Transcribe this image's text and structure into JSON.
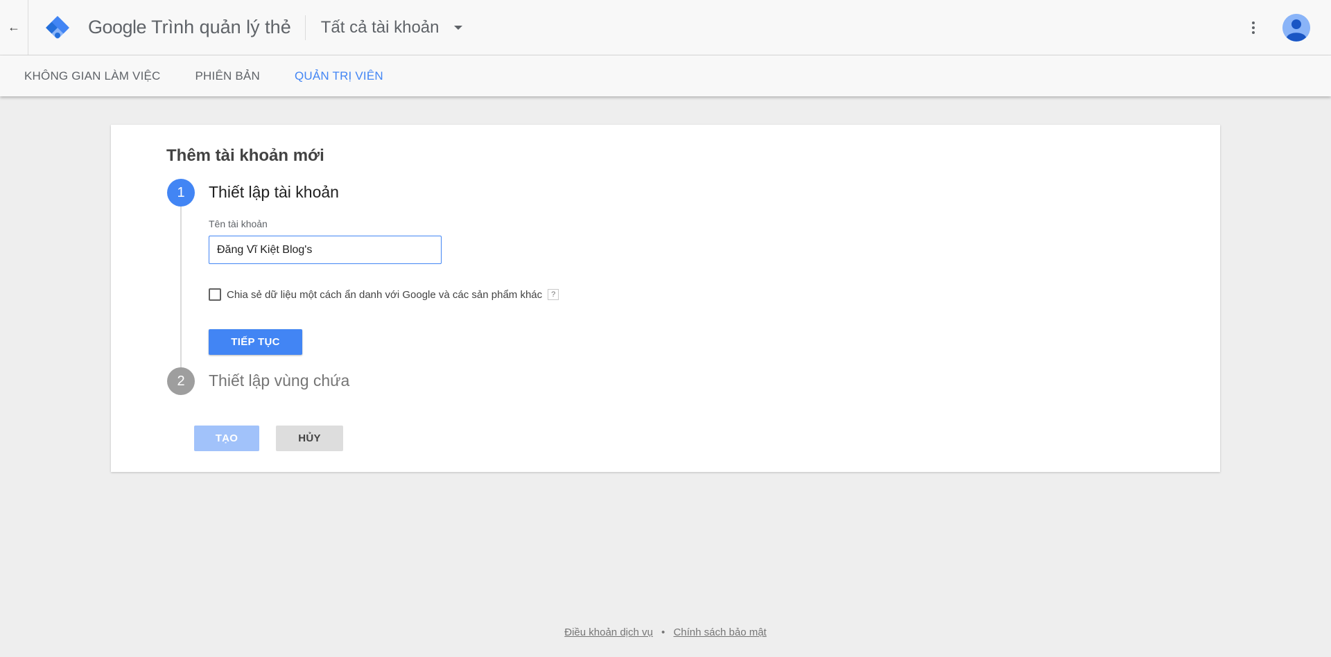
{
  "header": {
    "back_icon": "←",
    "logo_icon": "tag-manager-logo",
    "brand": "Google",
    "product": "Trình quản lý thẻ",
    "account_selector": "Tất cả tài khoản",
    "menu_icon": "more-vert-icon",
    "avatar_icon": "account-circle-icon"
  },
  "tabs": [
    {
      "label": "KHÔNG GIAN LÀM VIỆC",
      "active": false
    },
    {
      "label": "PHIÊN BẢN",
      "active": false
    },
    {
      "label": "QUẢN TRỊ VIÊN",
      "active": true
    }
  ],
  "card": {
    "title": "Thêm tài khoản mới",
    "step1": {
      "number": "1",
      "title": "Thiết lập tài khoản",
      "field_label": "Tên tài khoản",
      "field_value": "Đăng Vĩ Kiệt Blog's",
      "checkbox_label": "Chia sẻ dữ liệu một cách ẩn danh với Google và các sản phẩm khác",
      "checkbox_checked": false,
      "help": "?",
      "continue_label": "TIẾP TỤC"
    },
    "step2": {
      "number": "2",
      "title": "Thiết lập vùng chứa"
    },
    "create_label": "TẠO",
    "cancel_label": "HỦY"
  },
  "footer": {
    "terms": "Điều khoản dịch vụ",
    "separator": "•",
    "privacy": "Chính sách bảo mật"
  },
  "colors": {
    "accent": "#4285f4",
    "accent_disabled": "#a1c2fa",
    "step_inactive": "#9e9e9e",
    "background": "#eeeeee"
  }
}
